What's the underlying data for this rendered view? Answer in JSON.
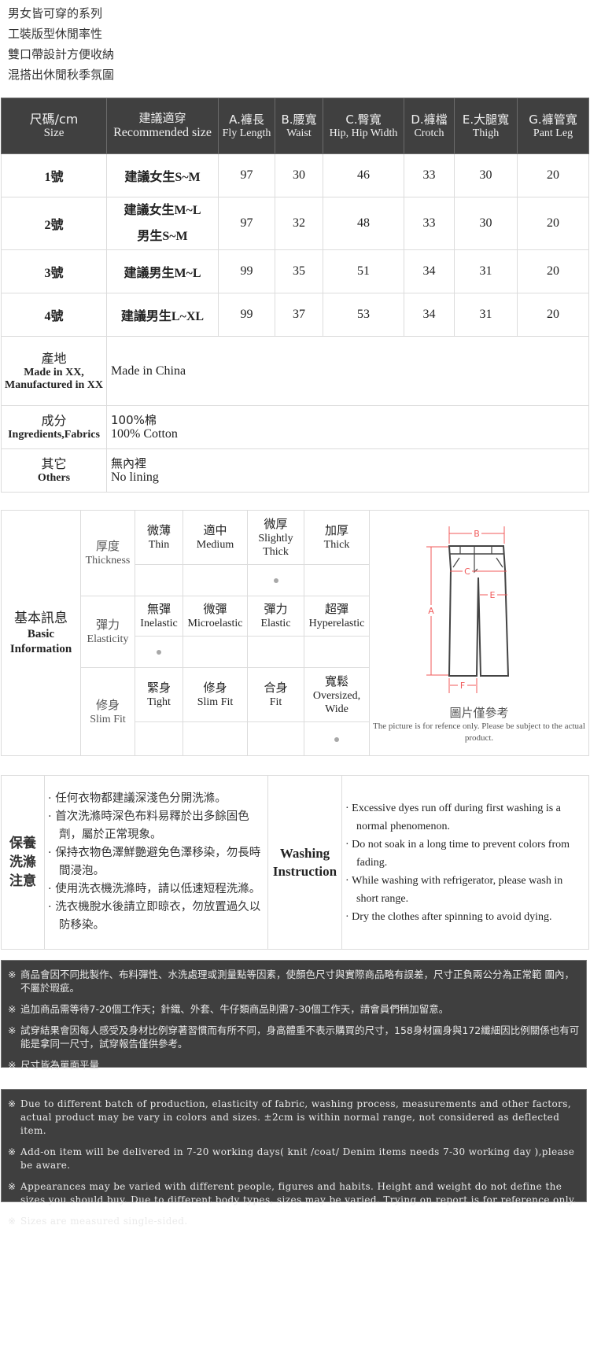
{
  "intro_lines": [
    "男女皆可穿的系列",
    "工裝版型休閒率性",
    "雙口帶設計方便收納",
    "混搭出休閒秋季氛圍"
  ],
  "size_table": {
    "headers": [
      {
        "zh": "尺碼/cm",
        "en": "Size"
      },
      {
        "zh": "建議適穿",
        "en": "Recommended size"
      },
      {
        "zh": "A.褲長",
        "en": "Fly Length"
      },
      {
        "zh": "B.腰寬",
        "en": "Waist"
      },
      {
        "zh": "C.臀寬",
        "en": "Hip, Hip Width"
      },
      {
        "zh": "D.褲檔",
        "en": "Crotch"
      },
      {
        "zh": "E.大腿寬",
        "en": "Thigh"
      },
      {
        "zh": "G.褲管寬",
        "en": "Pant Leg"
      }
    ],
    "rows": [
      {
        "size": "1號",
        "recommend": [
          "建議女生S~M"
        ],
        "values": [
          "97",
          "30",
          "46",
          "33",
          "30",
          "20"
        ]
      },
      {
        "size": "2號",
        "recommend": [
          "建議女生M~L",
          "男生S~M"
        ],
        "values": [
          "97",
          "32",
          "48",
          "33",
          "30",
          "20"
        ]
      },
      {
        "size": "3號",
        "recommend": [
          "建議男生M~L"
        ],
        "values": [
          "99",
          "35",
          "51",
          "34",
          "31",
          "20"
        ]
      },
      {
        "size": "4號",
        "recommend": [
          "建議男生L~XL"
        ],
        "values": [
          "99",
          "37",
          "53",
          "34",
          "31",
          "20"
        ]
      }
    ],
    "info": [
      {
        "label_zh": "產地",
        "label_en": "Made in XX, Manufactured in XX",
        "value_zh": "",
        "value_en": "Made in China"
      },
      {
        "label_zh": "成分",
        "label_en": "Ingredients,Fabrics",
        "value_zh": "100%棉",
        "value_en": "100% Cotton"
      },
      {
        "label_zh": "其它",
        "label_en": "Others",
        "value_zh": "無內裡",
        "value_en": "No lining"
      }
    ]
  },
  "basic_info": {
    "label_zh": "基本訊息",
    "label_en": "Basic Information",
    "categories": [
      {
        "zh": "厚度",
        "en": "Thickness",
        "options": [
          {
            "zh": "微薄",
            "en": "Thin"
          },
          {
            "zh": "適中",
            "en": "Medium"
          },
          {
            "zh": "微厚",
            "en": "Slightly Thick"
          },
          {
            "zh": "加厚",
            "en": "Thick"
          }
        ],
        "selected_index": 2
      },
      {
        "zh": "彈力",
        "en": "Elasticity",
        "options": [
          {
            "zh": "無彈",
            "en": "Inelastic"
          },
          {
            "zh": "微彈",
            "en": "Microelastic"
          },
          {
            "zh": "彈力",
            "en": "Elastic"
          },
          {
            "zh": "超彈",
            "en": "Hyperelastic"
          }
        ],
        "selected_index": 0
      },
      {
        "zh": "修身",
        "en": "Slim Fit",
        "options": [
          {
            "zh": "緊身",
            "en": "Tight"
          },
          {
            "zh": "修身",
            "en": "Slim Fit"
          },
          {
            "zh": "合身",
            "en": "Fit"
          },
          {
            "zh": "寬鬆",
            "en": "Oversized, Wide"
          }
        ],
        "selected_index": 3
      }
    ],
    "diagram": {
      "labels": [
        "A",
        "B",
        "C",
        "E",
        "F"
      ],
      "caption_zh": "圖片僅參考",
      "caption_en": "The picture is for refence only. Please be subject to the actual product.",
      "line_color": "#f05a5a"
    }
  },
  "washing": {
    "label_zh": "保養洗滌注意",
    "label_en": "Washing Instruction",
    "items_zh": [
      "任何衣物都建議深淺色分開洗滌。",
      "首次洗滌時深色布料易釋於出多餘固色劑，屬於正常現象。",
      "保持衣物色澤鮮艷避免色澤移染，勿長時間浸泡。",
      "使用洗衣機洗滌時，請以低速短程洗滌。",
      "洗衣機脫水後請立即晾衣，勿放置過久以防移染。"
    ],
    "items_en": [
      "Excessive dyes run off during first washing is a normal phenomenon.",
      "Do not soak in a long time to prevent colors from fading.",
      "While washing with refrigerator, please wash in short range.",
      "Dry the clothes after spinning to avoid dying."
    ]
  },
  "notes_zh": [
    "商品會因不同批製作、布料彈性、水洗處理或測量點等因素，使顏色尺寸與實際商品略有誤差，尺寸正負兩公分為正常範 圍內，不屬於瑕疵。",
    "追加商品需等待7-20個工作天；針織、外套、牛仔類商品則需7-30個工作天，請會員們稍加留意。",
    "試穿結果會因每人感受及身材比例穿著習慣而有所不同，身高體重不表示購買的尺寸，158身材圓身與172纖細因比例關係也有可能是拿同一尺寸，試穿報告僅供參考。",
    "尺寸皆為單面平量"
  ],
  "notes_en": [
    "Due to different batch of production, elasticity of fabric, washing process, measurements and other factors, actual product may be vary in colors and sizes. ±2cm is within normal range, not considered as deflected item.",
    "Add-on item will be delivered in 7-20 working days( knit /coat/ Denim items needs 7-30 working day ),please be aware.",
    "Appearances may be varied with different people, figures and habits. Height and weight do not define the sizes you should buy. Due to different body types, sizes may be varied. Trying on report is for reference only.",
    "Sizes are measured single-sided."
  ],
  "note_mark": "※"
}
